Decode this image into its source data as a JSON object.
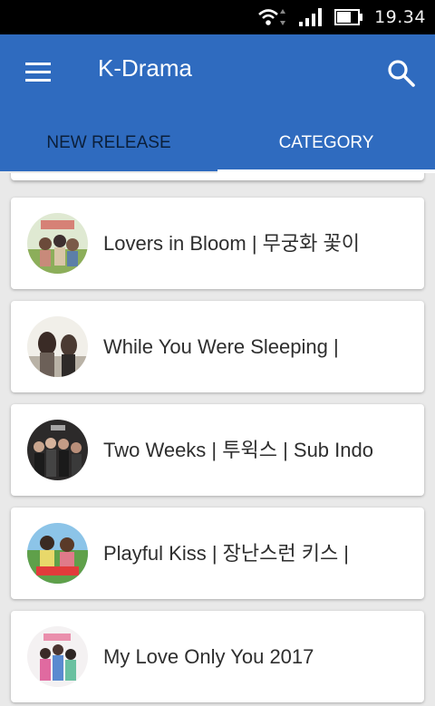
{
  "status_bar": {
    "time": "19.34"
  },
  "app_bar": {
    "title": "K-Drama"
  },
  "tabs": [
    {
      "label": "NEW RELEASE"
    },
    {
      "label": "CATEGORY"
    }
  ],
  "dramas": [
    {
      "title": "Lovers in Bloom | 무궁화 꽃이"
    },
    {
      "title": "While You Were Sleeping |"
    },
    {
      "title": "Two Weeks | 투윅스 | Sub Indo"
    },
    {
      "title": "Playful Kiss | 장난스런 키스 |"
    },
    {
      "title": "My Love Only You 2017"
    }
  ],
  "colors": {
    "app_bar": "#2f6bbf",
    "tab_active_text": "#ffffff",
    "tab_inactive_text": "#0b1f3a",
    "background": "#e9e9e9"
  }
}
